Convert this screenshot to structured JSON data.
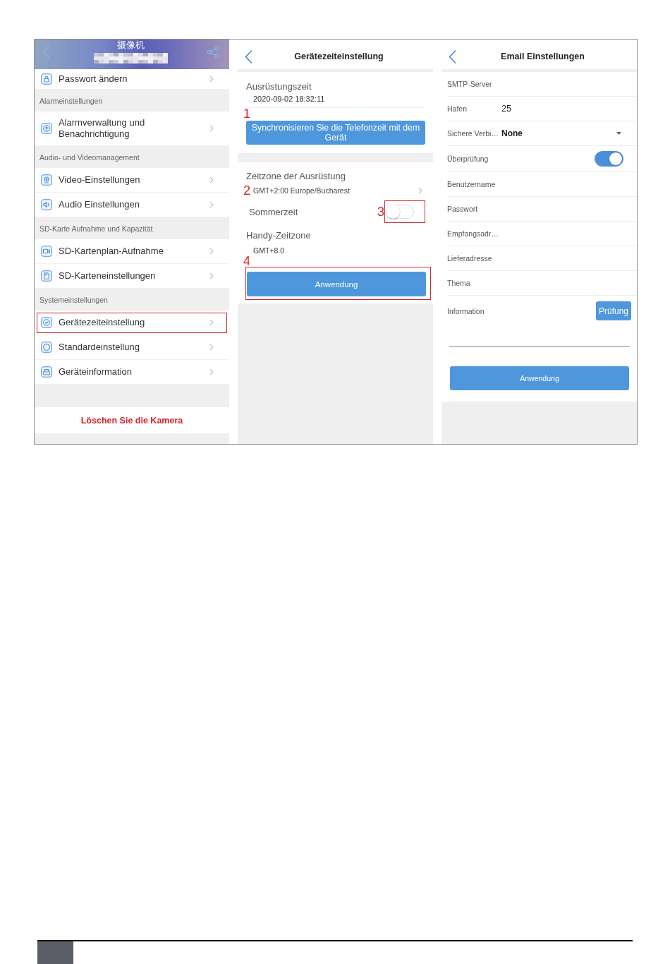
{
  "camera_menu": {
    "title": "摄像机",
    "items": [
      {
        "kind": "row",
        "label": "Passwort ändern",
        "highlighted": false
      },
      {
        "kind": "section",
        "label": "Alarmeinstellungen"
      },
      {
        "kind": "row",
        "label": "Alarmverwaltung und Benachrichtigung",
        "highlighted": false
      },
      {
        "kind": "section",
        "label": "Audio- und Videomanagement"
      },
      {
        "kind": "row",
        "label": "Video-Einstellungen",
        "highlighted": false
      },
      {
        "kind": "row",
        "label": "Audio Einstellungen",
        "highlighted": false
      },
      {
        "kind": "section",
        "label": "SD-Karte Aufnahme und Kapazität"
      },
      {
        "kind": "row",
        "label": "SD-Kartenplan-Aufnahme",
        "highlighted": false
      },
      {
        "kind": "row",
        "label": "SD-Karteneinstellungen",
        "highlighted": false
      },
      {
        "kind": "section",
        "label": "Systemeinstellungen"
      },
      {
        "kind": "row",
        "label": "Gerätezeiteinstellung",
        "highlighted": true
      },
      {
        "kind": "row",
        "label": "Standardeinstellung",
        "highlighted": false
      },
      {
        "kind": "row",
        "label": "Geräteinformation",
        "highlighted": false
      }
    ],
    "delete_button": "Löschen Sie die Kamera"
  },
  "time_settings": {
    "title": "Gerätezeiteinstellung",
    "device_time_label": "Ausrüstungszeit",
    "device_time": "2020-09-02 18:32:11",
    "sync_button": {
      "label": "Synchronisieren Sie die Telefonzeit mit dem Gerät",
      "annotation": {
        "kind": "number",
        "number": "1"
      }
    },
    "timezone_label": "Zeitzone der Ausrüstung",
    "timezone": {
      "value": "GMT+2:00 Europe/Bucharest",
      "annotation": {
        "kind": "number",
        "number": "2"
      }
    },
    "dst": {
      "label": "Sommerzeit",
      "on": false,
      "annotation": {
        "kind": "framed_number",
        "number": "3"
      }
    },
    "phone_timezone_label": "Handy-Zeitzone",
    "phone_timezone": "GMT+8.0",
    "apply_button": {
      "label": "Anwendung",
      "annotation": {
        "kind": "framed_number",
        "number": "4"
      }
    }
  },
  "email_settings": {
    "title": "Email Einstellungen",
    "fields": [
      {
        "kind": "text",
        "label": "SMTP-Server"
      },
      {
        "kind": "text",
        "label": "Hafen",
        "value": "25"
      },
      {
        "kind": "select",
        "label": "Sichere Verbi…",
        "value": "None"
      },
      {
        "kind": "toggle",
        "label": "Überprüfung",
        "on": true
      },
      {
        "kind": "text",
        "label": "Benutzername"
      },
      {
        "kind": "text",
        "label": "Passwort"
      },
      {
        "kind": "text",
        "label": "Empfangsadr…"
      },
      {
        "kind": "text",
        "label": "Lieferadresse"
      },
      {
        "kind": "text",
        "label": "Thema"
      },
      {
        "kind": "button",
        "label": "Information",
        "button": "Prüfung"
      }
    ],
    "apply_button": "Anwendung"
  }
}
